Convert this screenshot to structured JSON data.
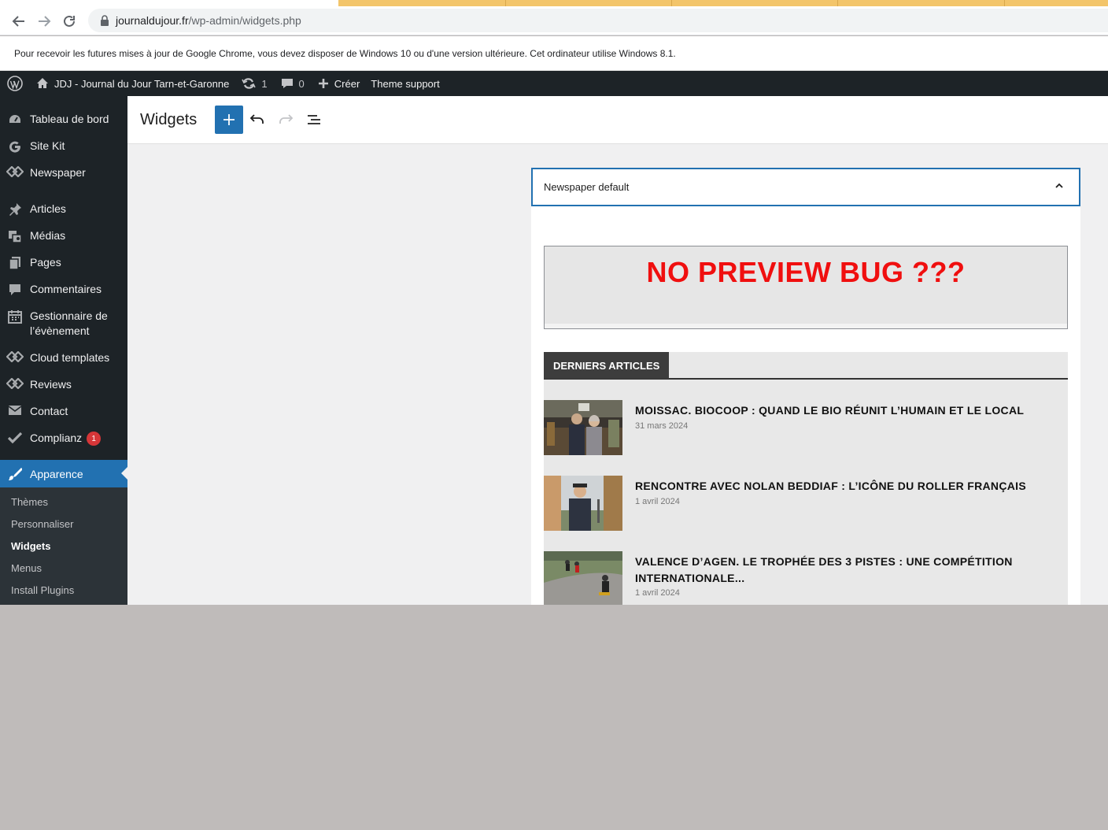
{
  "browser": {
    "url_host": "journaldujour.fr",
    "url_path": "/wp-admin/widgets.php",
    "infobar_message": "Pour recevoir les futures mises à jour de Google Chrome, vous devez disposer de Windows 10 ou d'une version ultérieure. Cet ordinateur utilise Windows 8.1."
  },
  "adminbar": {
    "site_name": "JDJ - Journal du Jour Tarn-et-Garonne",
    "updates_count": "1",
    "comments_count": "0",
    "new_label": "Créer",
    "theme_support": "Theme support"
  },
  "sidebar": {
    "items": [
      {
        "label": "Tableau de bord",
        "icon": "dashboard-icon"
      },
      {
        "label": "Site Kit",
        "icon": "google-g-icon"
      },
      {
        "label": "Newspaper",
        "icon": "newspaper-icon"
      },
      {
        "label": "Articles",
        "icon": "pin-icon"
      },
      {
        "label": "Médias",
        "icon": "media-icon"
      },
      {
        "label": "Pages",
        "icon": "pages-icon"
      },
      {
        "label": "Commentaires",
        "icon": "comment-icon"
      },
      {
        "label": "Gestionnaire de",
        "label2": "l’évènement",
        "icon": "calendar-icon"
      },
      {
        "label": "Cloud templates",
        "icon": "tagdiv-icon"
      },
      {
        "label": "Reviews",
        "icon": "tagdiv-icon"
      },
      {
        "label": "Contact",
        "icon": "mail-icon"
      },
      {
        "label": "Complianz",
        "icon": "check-icon",
        "badge": "1"
      }
    ],
    "active": {
      "label": "Apparence",
      "icon": "paintbrush-icon"
    },
    "submenu": [
      {
        "label": "Thèmes"
      },
      {
        "label": "Personnaliser"
      },
      {
        "label": "Widgets",
        "current": true
      },
      {
        "label": "Menus"
      },
      {
        "label": "Install Plugins"
      }
    ]
  },
  "editor": {
    "title": "Widgets",
    "area_name": "Newspaper default",
    "preview_message": "NO PREVIEW BUG ???",
    "block_heading": "DERNIERS ARTICLES",
    "posts": [
      {
        "title": "MOISSAC. BIOCOOP : QUAND LE BIO RÉUNIT L’HUMAIN ET LE LOCAL",
        "date": "31 mars 2024"
      },
      {
        "title": "RENCONTRE AVEC NOLAN BEDDIAF : L’ICÔNE DU ROLLER FRANÇAIS",
        "date": "1 avril 2024"
      },
      {
        "title": "VALENCE D’AGEN. LE TROPHÉE DES 3 PISTES : UNE COMPÉTITION INTERNATIONALE...",
        "date": "1 avril 2024"
      }
    ]
  },
  "colors": {
    "wp_dark": "#1d2327",
    "wp_blue": "#2271b1",
    "preview_red": "#f00f0f"
  }
}
